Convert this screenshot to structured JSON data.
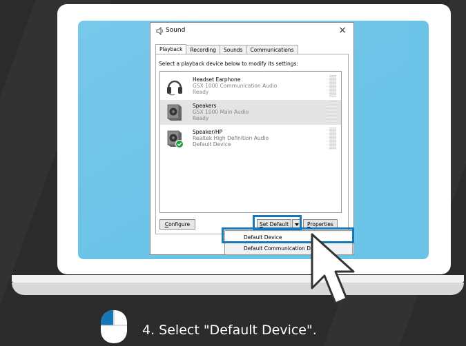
{
  "dialog": {
    "title": "Sound",
    "close_glyph": "×",
    "tabs": [
      {
        "label": "Playback",
        "active": true
      },
      {
        "label": "Recording",
        "active": false
      },
      {
        "label": "Sounds",
        "active": false
      },
      {
        "label": "Communications",
        "active": false
      }
    ],
    "instruction": "Select a playback device below to modify its settings:",
    "devices": [
      {
        "name": "Headset Earphone",
        "model": "GSX 1000 Communication Audio",
        "status": "Ready",
        "icon": "headset-icon",
        "selected": false
      },
      {
        "name": "Speakers",
        "model": "GSX 1000 Main Audio",
        "status": "Ready",
        "icon": "speaker-icon",
        "selected": true
      },
      {
        "name": "Speaker/HP",
        "model": "Realtek High Definition Audio",
        "status": "Default Device",
        "icon": "speaker-default-icon",
        "selected": false
      }
    ],
    "buttons": {
      "configure_prefix": "C",
      "configure_rest": "onfigure",
      "set_default_prefix": "S",
      "set_default_rest": "et Default",
      "properties_prefix": "P",
      "properties_rest": "roperties"
    }
  },
  "dropdown_menu": {
    "items": [
      {
        "label": "Default Device",
        "highlighted": true
      },
      {
        "label": "Default Communication Device",
        "highlighted": false
      }
    ]
  },
  "instruction_step": {
    "text": "4. Select \"Default Device\".",
    "icon": "mouse-left-click-icon"
  },
  "colors": {
    "highlight_blue": "#1676b6",
    "screen_blue": "#6cc3e8",
    "background": "#2b2b2b",
    "default_check_green": "#1f9d3a"
  }
}
